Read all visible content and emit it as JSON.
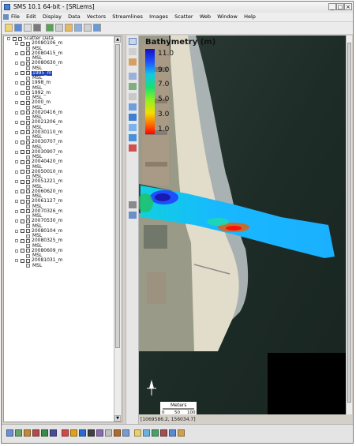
{
  "window": {
    "title": "SMS 10.1 64-bit - [SRLems]",
    "controls": [
      "_",
      "□",
      "×"
    ]
  },
  "menu": {
    "items": [
      "File",
      "Edit",
      "Display",
      "Data",
      "Vectors",
      "Scatter",
      "Images",
      "Scatter",
      "Web",
      "Window",
      "Help"
    ],
    "items_render": [
      "File",
      "Edit",
      "Display",
      "Data",
      "Vectors",
      "Streamlines",
      "Images",
      "Scatter",
      "Web",
      "Window",
      "Help"
    ]
  },
  "tree": {
    "root_label": "Scatter Data",
    "datasets": [
      {
        "label": "20080106_m",
        "child": "MSL"
      },
      {
        "label": "20080415_m",
        "child": "MSL"
      },
      {
        "label": "20080630_m",
        "child": "MSL"
      },
      {
        "label": "1995_m",
        "child": "MSL",
        "selected": true
      },
      {
        "label": "1998_m",
        "child": "MSL"
      },
      {
        "label": "1992_m",
        "child": "MSL"
      },
      {
        "label": "2000_m",
        "child": "MSL"
      },
      {
        "label": "20020416_m",
        "child": "MSL"
      },
      {
        "label": "20021206_m",
        "child": "MSL"
      },
      {
        "label": "20030110_m",
        "child": "MSL"
      },
      {
        "label": "20030707_m",
        "child": "MSL"
      },
      {
        "label": "20030907_m",
        "child": "MSL"
      },
      {
        "label": "20040420_m",
        "child": "MSL"
      },
      {
        "label": "20050010_m",
        "child": "MSL"
      },
      {
        "label": "20051221_m",
        "child": "MSL"
      },
      {
        "label": "20060620_m",
        "child": "MSL"
      },
      {
        "label": "20061127_m",
        "child": "MSL"
      },
      {
        "label": "20070326_m",
        "child": "MSL"
      },
      {
        "label": "20070530_m",
        "child": "MSL"
      },
      {
        "label": "20080104_m",
        "child": "MSL"
      },
      {
        "label": "20080325_m",
        "child": "MSL"
      },
      {
        "label": "20080609_m",
        "child": "MSL"
      },
      {
        "label": "20081031_m",
        "child": "MSL"
      }
    ]
  },
  "legend": {
    "title": "Bathymetry (m)",
    "labels": [
      "11.0",
      "9.0",
      "7.0",
      "5.0",
      "3.0",
      "1.0"
    ]
  },
  "scale": {
    "label": "Meters",
    "ticks": [
      "0",
      "50",
      "100"
    ]
  },
  "status": {
    "coords": "[1069586.2, 156034.7]"
  },
  "colors": {
    "selection": "#1a3fb8",
    "bathy_deep": "#1a1ab0",
    "bathy_shallow": "#ff1000"
  }
}
